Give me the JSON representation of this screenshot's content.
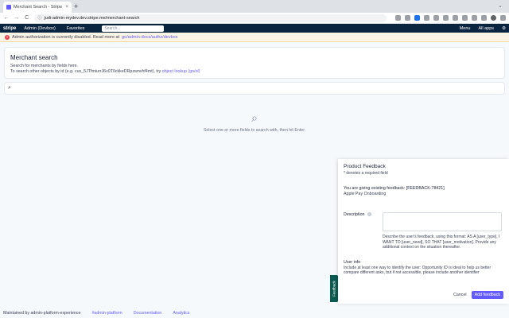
{
  "browser": {
    "tab_title": "Merchant Search - Stripe Ad",
    "tab_close": "×",
    "new_tab": "+",
    "url": "judi-admin-mydev.dev.stripe.me/merchant-search",
    "back": "←",
    "forward": "→",
    "reload": "C",
    "lock": "ⓘ",
    "tab_menu": "⌄"
  },
  "appnav": {
    "brand": "stripe",
    "env": "Admin (Devbox)",
    "favorites": "Favorites",
    "search_placeholder": "Search...",
    "menu": "Menu",
    "all_apps": "All apps",
    "settings_icon": "⚙"
  },
  "alert": {
    "icon": "!",
    "text": "Admin authorization is currently disabled. Read more at",
    "link": "go/admin-docs/authz/devbox"
  },
  "header": {
    "title": "Merchant search",
    "line1": "Search for merchants by fields here.",
    "line2_prefix": "To search other objects by id (e.g. cus_5JTfmiurrJ6v0T0ckkeDRpzwnvhf4mt), try",
    "line2_link": "object lookup (go/ol)"
  },
  "search": {
    "icon": "⌕",
    "placeholder": ""
  },
  "empty_state": {
    "icon": "⌕",
    "text": "Select one or more fields to search with, then hit Enter."
  },
  "footer": {
    "maintained": "Maintained by admin-platform-experience",
    "channel": "#admin-platform",
    "docs": "Documentation",
    "analytics": "Analytics"
  },
  "feedback": {
    "side_tab": "Feedback",
    "title": "Product Feedback",
    "required_note": "* denotes a required field",
    "context_label": "You are giving existing feedback: [FEEDBACK-78421]",
    "context_value": "Apple Pay Onboarding",
    "description_label": "Description",
    "help_icon": "?",
    "description_value": "",
    "description_hint": "Describe the user's feedback, using this format: AS A [user_type], I WANT TO [user_need], SO THAT [user_motivation]. Provide any additional context on the situation thereafter.",
    "user_info_label": "User info",
    "user_info_hint": "Include at least one way to identify the user: Opportunity ID is ideal to help us better compare different asks, but if not accessible, please include another identifier",
    "cancel": "Cancel",
    "submit": "Add feedback"
  }
}
